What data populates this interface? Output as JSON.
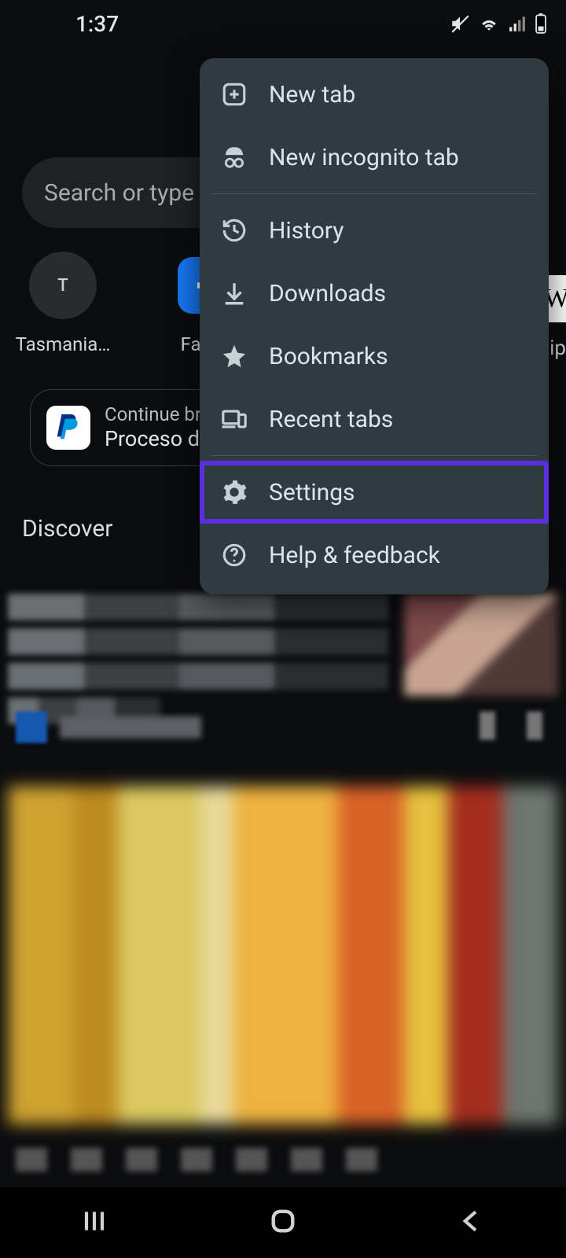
{
  "status": {
    "time": "1:37"
  },
  "search": {
    "placeholder": "Search or type web address"
  },
  "shortcuts": [
    {
      "label": "Tasmania…",
      "letter": "T"
    },
    {
      "label": "Faceb"
    }
  ],
  "edge": {
    "letter": "W",
    "label": "ip"
  },
  "continue": {
    "line1": "Continue brow",
    "line2": "Proceso de"
  },
  "discover": {
    "heading": "Discover"
  },
  "menu": {
    "new_tab": "New tab",
    "new_incognito": "New incognito tab",
    "history": "History",
    "downloads": "Downloads",
    "bookmarks": "Bookmarks",
    "recent_tabs": "Recent tabs",
    "settings": "Settings",
    "help": "Help & feedback"
  },
  "colors": {
    "highlight": "#5a2fe0",
    "menu_bg": "#2e3c42"
  }
}
